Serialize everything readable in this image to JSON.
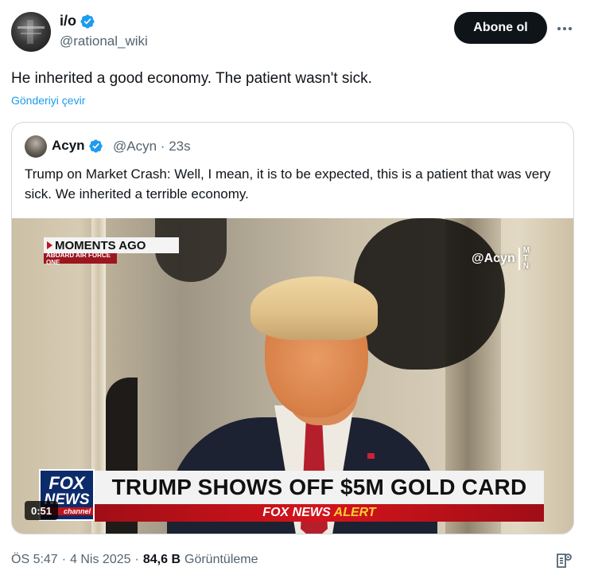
{
  "author": {
    "name": "i/o",
    "handle": "@rational_wiki",
    "verified": true
  },
  "actions": {
    "follow_label": "Abone ol",
    "more_icon": "more-horizontal-icon"
  },
  "tweet": {
    "text": "He inherited a good economy. The patient wasn't sick.",
    "translate_label": "Gönderiyi çevir"
  },
  "quote": {
    "name": "Acyn",
    "handle": "@Acyn",
    "separator": "·",
    "age": "23s",
    "text": "Trump on Market Crash: Well, I mean, it is to be expected, this is a patient that was very sick. We inherited a terrible economy.",
    "media": {
      "moments_label": "MOMENTS AGO",
      "aboard_label": "ABOARD AIR FORCE ONE",
      "watermark": "@Acyn",
      "watermark_stack": [
        "M",
        "T",
        "N"
      ],
      "logo_top": "FOX",
      "logo_mid": "NEWS",
      "logo_bottom": "channel",
      "chyron": "TRUMP SHOWS OFF $5M GOLD CARD",
      "alert_brand": "FOX NEWS",
      "alert_word": "ALERT",
      "duration": "0:51"
    }
  },
  "footer": {
    "time": "ÖS 5:47",
    "dot1": "·",
    "date": "4 Nis 2025",
    "dot2": "·",
    "views_count": "84,6 B",
    "views_label": "Görüntüleme"
  },
  "colors": {
    "accent": "#1d9bf0",
    "text": "#0f1419",
    "muted": "#536471",
    "border": "#cfd9de"
  }
}
